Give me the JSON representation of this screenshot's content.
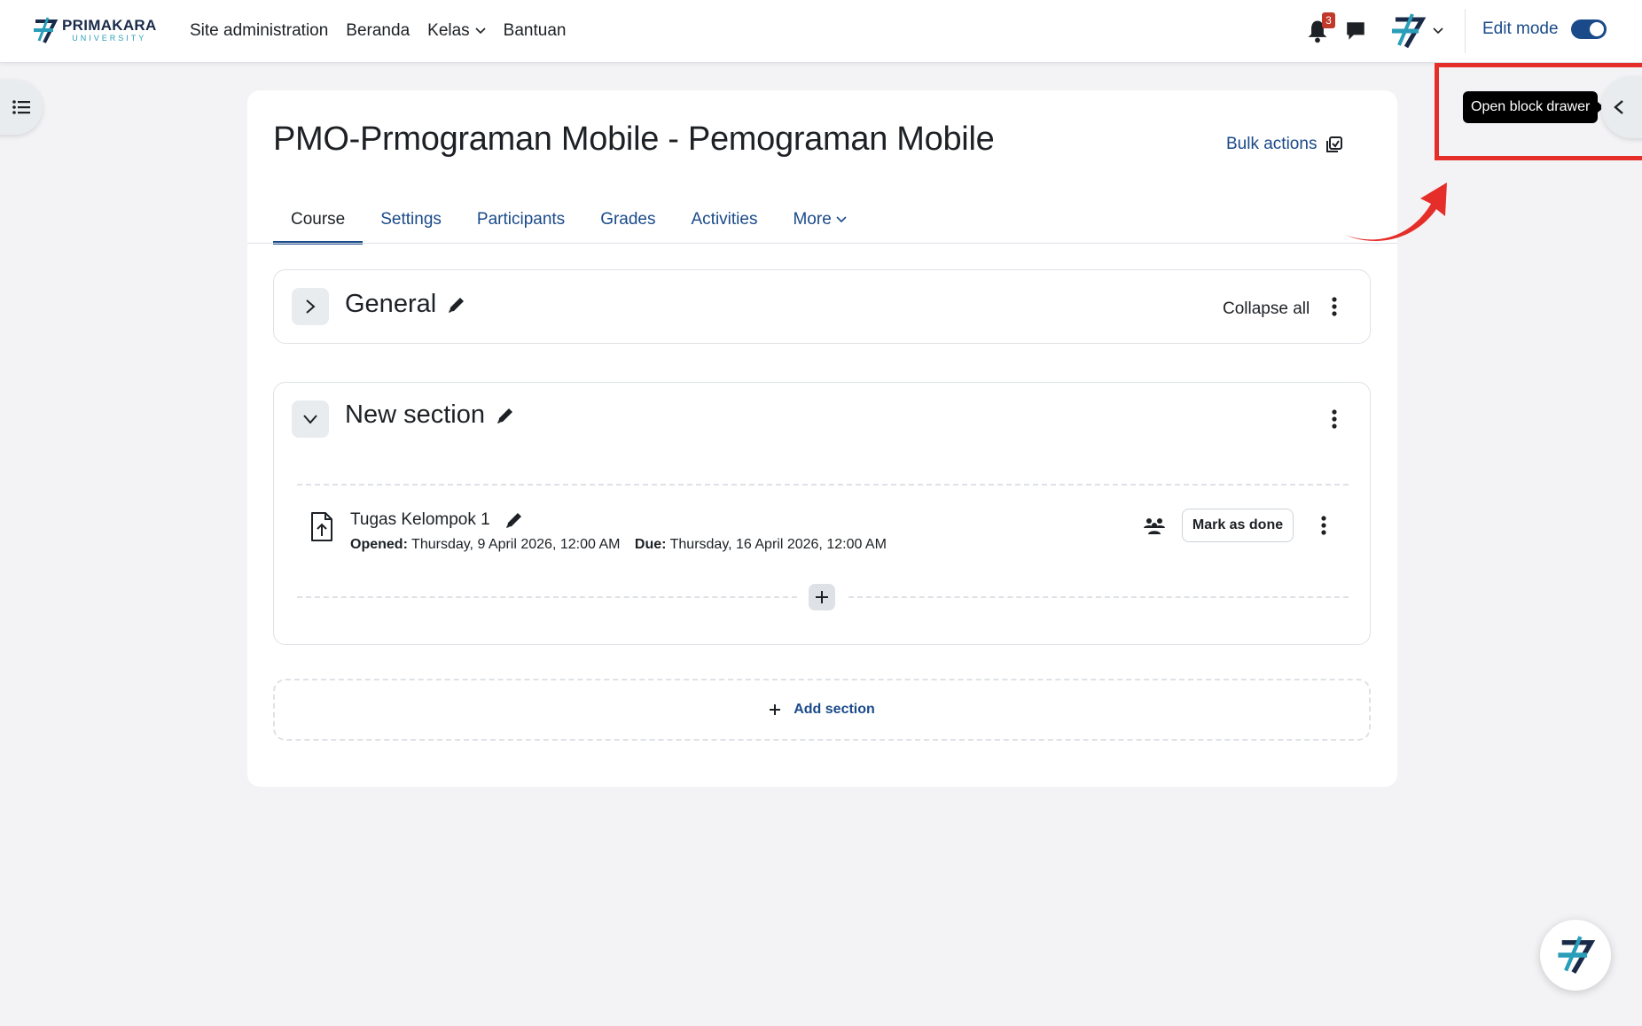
{
  "brand": {
    "name": "PRIMAKARA",
    "sub": "UNIVERSITY"
  },
  "nav": {
    "links": [
      {
        "label": "Site administration"
      },
      {
        "label": "Beranda"
      },
      {
        "label": "Kelas"
      },
      {
        "label": "Bantuan"
      }
    ],
    "notification_count": "3",
    "edit_mode_label": "Edit mode",
    "edit_mode_on": true
  },
  "course": {
    "title": "PMO-Prmograman Mobile - Pemograman Mobile",
    "bulk_actions": "Bulk actions",
    "tabs": [
      {
        "label": "Course",
        "active": true
      },
      {
        "label": "Settings"
      },
      {
        "label": "Participants"
      },
      {
        "label": "Grades"
      },
      {
        "label": "Activities"
      },
      {
        "label": "More"
      }
    ]
  },
  "sections": {
    "general": {
      "title": "General",
      "collapse_all": "Collapse all"
    },
    "new": {
      "title": "New section",
      "activity": {
        "name": "Tugas Kelompok 1",
        "opened_label": "Opened:",
        "opened_value": "Thursday, 9 April 2026, 12:00 AM",
        "due_label": "Due:",
        "due_value": "Thursday, 16 April 2026, 12:00 AM",
        "mark_done": "Mark as done"
      }
    },
    "add_section": "Add section"
  },
  "drawer": {
    "tooltip": "Open block drawer"
  },
  "colors": {
    "accent": "#1a4a8a",
    "annotation": "#e52e2a",
    "badge": "#c0392b"
  }
}
